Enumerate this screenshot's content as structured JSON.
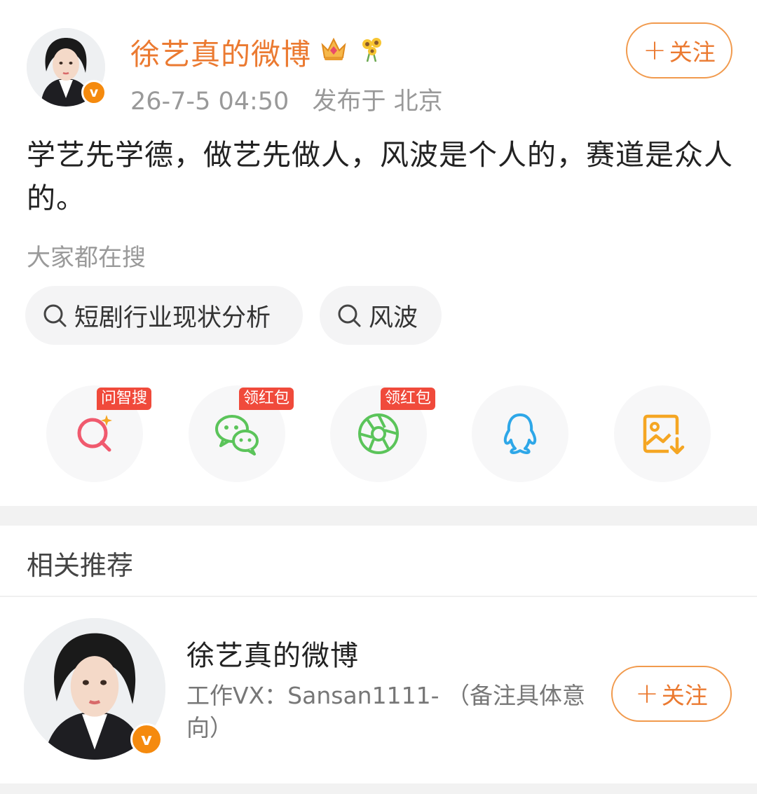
{
  "post": {
    "username": "徐艺真的微博",
    "time": "26-7-5 04:50",
    "location": "发布于 北京",
    "follow_label": "关注",
    "follow_plus": "+",
    "verified_mark": "v",
    "text": "学艺先学德，做艺先做人，风波是个人的，赛道是众人的。"
  },
  "search": {
    "label": "大家都在搜",
    "chips": [
      "短剧行业现状分析",
      "风波"
    ]
  },
  "share": {
    "items": [
      {
        "icon": "ai-search-icon",
        "tag": "问智搜"
      },
      {
        "icon": "wechat-icon",
        "tag": "领红包"
      },
      {
        "icon": "moments-icon",
        "tag": "领红包"
      },
      {
        "icon": "qq-icon",
        "tag": ""
      },
      {
        "icon": "save-image-icon",
        "tag": ""
      }
    ],
    "colors": {
      "ai": "#f05a6e",
      "wechat": "#5bc45a",
      "qq": "#2ea7e8",
      "save": "#f5a623",
      "tag": "#f04a3b"
    }
  },
  "recommend": {
    "title": "相关推荐",
    "name": "徐艺真的微博",
    "desc": "工作VX：Sansan1111- （备注具体意向）",
    "follow_label": "关注",
    "follow_plus": "+",
    "verified_mark": "v"
  },
  "colors": {
    "accent": "#eb7a31",
    "badge": "#f58a0e"
  }
}
